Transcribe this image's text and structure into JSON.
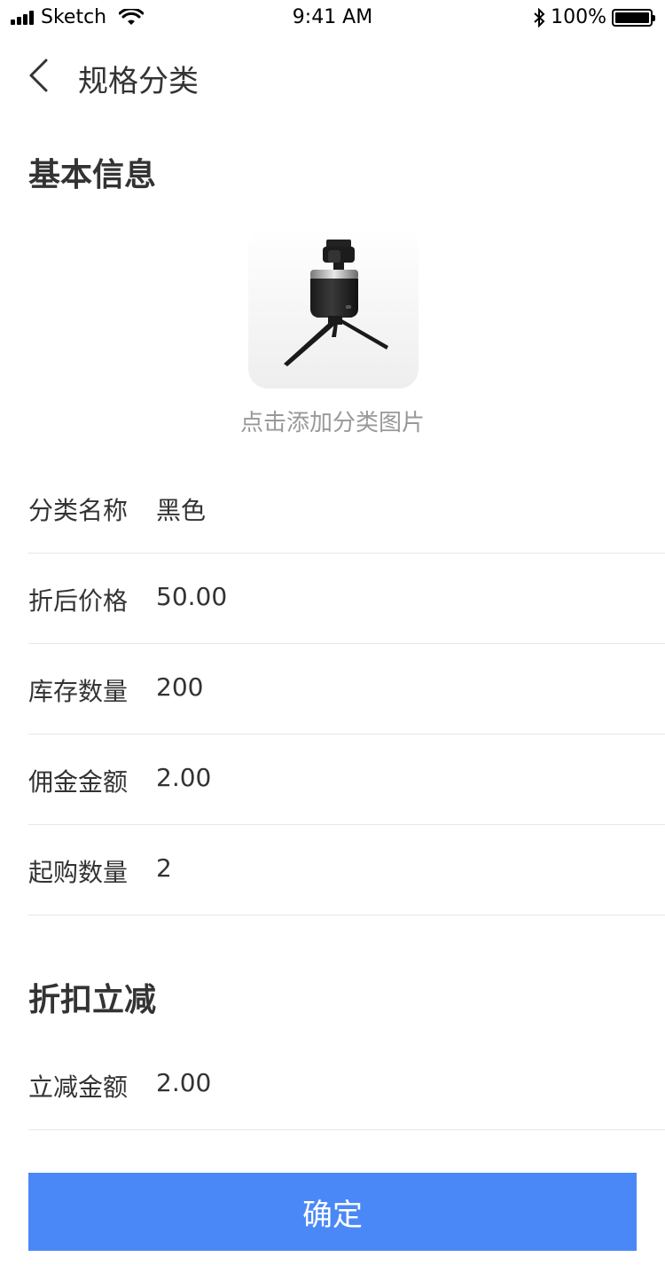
{
  "status_bar": {
    "carrier": "Sketch",
    "time": "9:41 AM",
    "battery": "100%"
  },
  "nav": {
    "title": "规格分类"
  },
  "basic_info": {
    "title": "基本信息",
    "photo_hint": "点击添加分类图片",
    "fields": [
      {
        "label": "分类名称",
        "value": "黑色"
      },
      {
        "label": "折后价格",
        "value": "50.00"
      },
      {
        "label": "库存数量",
        "value": "200"
      },
      {
        "label": "佣金金额",
        "value": "2.00"
      },
      {
        "label": "起购数量",
        "value": "2"
      }
    ]
  },
  "discount": {
    "title": "折扣立减",
    "fields": [
      {
        "label": "立减金额",
        "value": "2.00"
      }
    ]
  },
  "confirm_label": "确定",
  "colors": {
    "accent": "#4a88f7",
    "text": "#333333",
    "hint": "#999999",
    "divider": "#e6e6e6"
  }
}
